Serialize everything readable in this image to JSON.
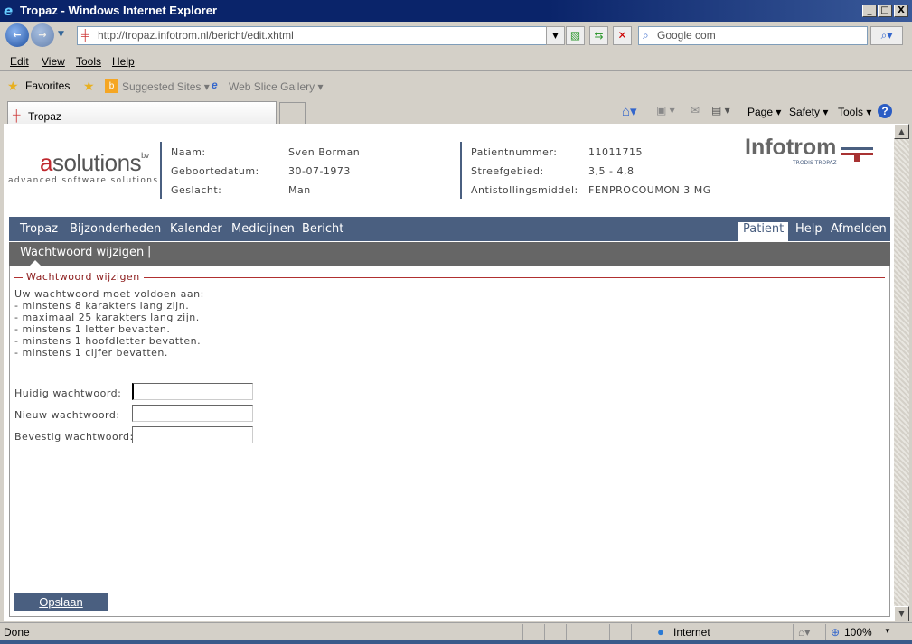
{
  "window": {
    "title": "Tropaz - Windows Internet Explorer",
    "minimize": "_",
    "maximize": "□",
    "close": "X"
  },
  "browser": {
    "url": "http://tropaz.infotrom.nl/bericht/edit.xhtml",
    "search_placeholder": "Google com",
    "menu": [
      "Edit",
      "View",
      "Tools",
      "Help"
    ],
    "favorites": {
      "label": "Favorites",
      "suggested": "Suggested Sites",
      "webslice": "Web Slice Gallery"
    },
    "tab_title": "Tropaz",
    "command_bar": {
      "page": "Page",
      "safety": "Safety",
      "tools": "Tools"
    },
    "status": {
      "text": "Done",
      "zone": "Internet",
      "zoom": "100%"
    }
  },
  "logo": {
    "brand": "asolutions",
    "suffix": "bv",
    "tagline": "advanced software solutions"
  },
  "partner_logo": {
    "name": "Infotrom",
    "sub": "TRODIS TROPAZ"
  },
  "patient": {
    "left": [
      {
        "label": "Naam:",
        "value": "Sven Borman"
      },
      {
        "label": "Geboortedatum:",
        "value": "30-07-1973"
      },
      {
        "label": "Geslacht:",
        "value": "Man"
      }
    ],
    "right": [
      {
        "label": "Patientnummer:",
        "value": "11011715"
      },
      {
        "label": "Streefgebied:",
        "value": "3,5 - 4,8"
      },
      {
        "label": "Antistollingsmiddel:",
        "value": "FENPROCOUMON 3 MG"
      }
    ]
  },
  "nav": {
    "left": [
      "Tropaz",
      "Bijzonderheden",
      "Kalender",
      "Medicijnen",
      "Bericht"
    ],
    "right": [
      "Patient",
      "Help",
      "Afmelden"
    ],
    "active": "Patient"
  },
  "subnav": {
    "item": "Wachtwoord wijzigen",
    "separator": "|"
  },
  "form": {
    "legend": "Wachtwoord wijzigen",
    "intro": "Uw wachtwoord moet voldoen aan:",
    "rules": [
      "- minstens 8 karakters lang zijn.",
      "- maximaal 25 karakters lang zijn.",
      "- minstens 1 letter bevatten.",
      "- minstens 1 hoofdletter bevatten.",
      "- minstens 1 cijfer bevatten."
    ],
    "fields": [
      {
        "label": "Huidig wachtwoord:",
        "value": ""
      },
      {
        "label": "Nieuw wachtwoord:",
        "value": ""
      },
      {
        "label": "Bevestig wachtwoord:",
        "value": ""
      }
    ],
    "save": "Opslaan"
  },
  "colors": {
    "nav": "#4a5f80",
    "subnav": "#666666",
    "legend": "#8b1a1a",
    "brand_red": "#c0282f"
  }
}
